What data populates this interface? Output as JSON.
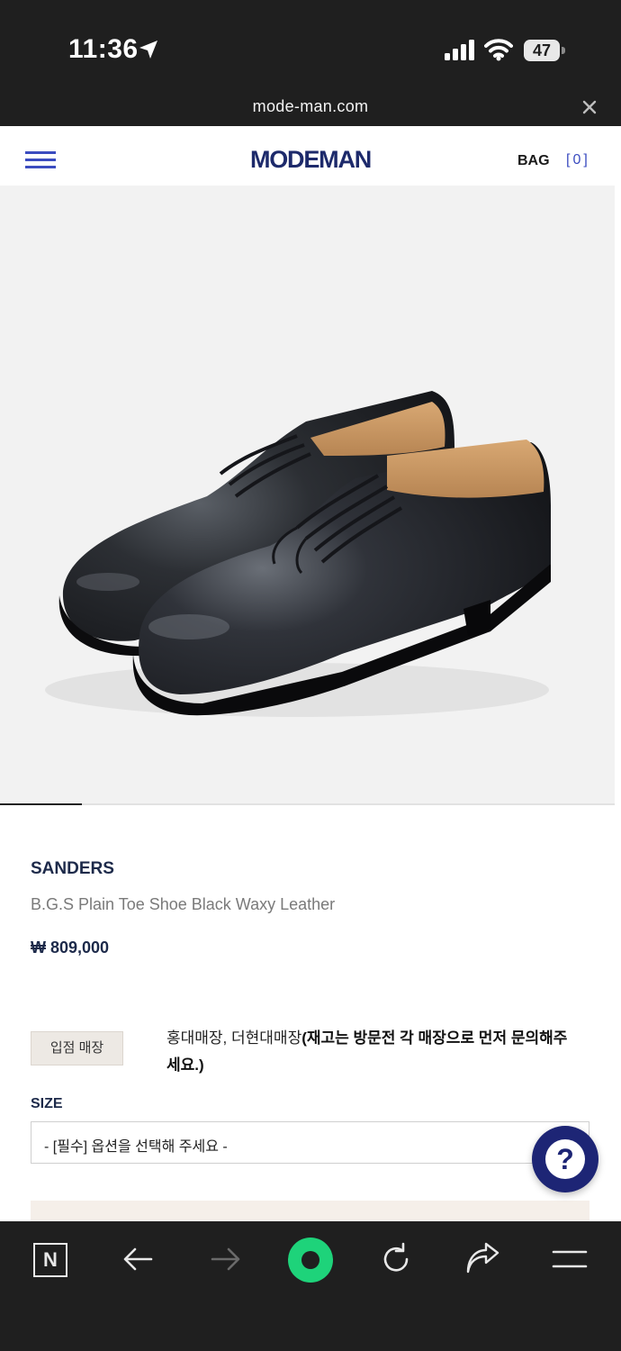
{
  "status_bar": {
    "time": "11:36",
    "battery": "47",
    "icons": [
      "location-arrow-icon",
      "cellular-signal-icon",
      "wifi-icon",
      "battery-icon"
    ]
  },
  "browser": {
    "url": "mode-man.com",
    "close_icon": "close-icon"
  },
  "header": {
    "menu_icon": "hamburger-menu-icon",
    "logo": "MODEMAN",
    "bag_label": "BAG",
    "bag_count": "[0]",
    "accent_color": "#3b4cc0",
    "logo_color": "#1d2a6b"
  },
  "gallery": {
    "image": "black leather plain toe derby shoes",
    "slide_progress": 0.133
  },
  "product": {
    "brand": "SANDERS",
    "name": "B.G.S Plain Toe Shoe Black Waxy Leather",
    "price": "₩ 809,000"
  },
  "store": {
    "badge": "입점 매장",
    "stores": "홍대매장, 더현대매장",
    "note": "(재고는 방문전 각 매장으로 먼저 문의해주세요.)"
  },
  "size": {
    "label": "SIZE",
    "selected": "- [필수] 옵션을 선택해 주세요 -"
  },
  "help": {
    "label": "?",
    "color": "#1d2575"
  },
  "toolbar": {
    "tab_label": "N",
    "icons": [
      "tabs-icon",
      "back-arrow-icon",
      "forward-arrow-icon",
      "home-icon",
      "reload-icon",
      "share-icon",
      "more-menu-icon"
    ],
    "home_color": "#1ed37a"
  }
}
